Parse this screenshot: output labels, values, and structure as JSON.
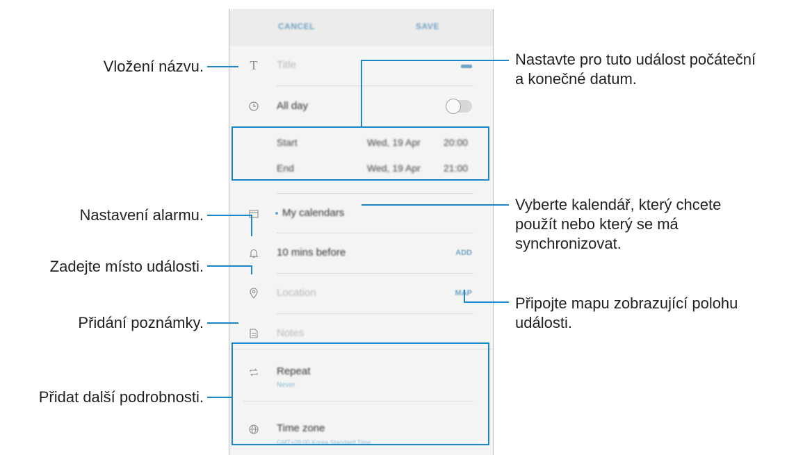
{
  "appbar": {
    "cancel_label": "CANCEL",
    "save_label": "SAVE"
  },
  "form": {
    "title_placeholder": "Title",
    "allday_label": "All day",
    "start_label": "Start",
    "start_date": "Wed, 19 Apr",
    "start_time": "20:00",
    "end_label": "End",
    "end_date": "Wed, 19 Apr",
    "end_time": "21:00",
    "calendar_label": "My calendars",
    "alarm_label": "10 mins before",
    "alarm_action": "ADD",
    "location_placeholder": "Location",
    "location_action": "MAP",
    "notes_placeholder": "Notes",
    "repeat_label": "Repeat",
    "repeat_value": "Never",
    "timezone_label": "Time zone",
    "timezone_value": "GMT+09:00 Korea Standard Time"
  },
  "callouts": {
    "title": "Vložení názvu.",
    "dates_line1": "Nastavte pro tuto událost počáteční",
    "dates_line2": "a konečné datum.",
    "alarm": "Nastavení alarmu.",
    "calendar_line1": "Vyberte kalendář, který chcete",
    "calendar_line2": "použít nebo který se má",
    "calendar_line3": "synchronizovat.",
    "location": "Zadejte místo události.",
    "map_line1": "Připojte mapu zobrazující polohu",
    "map_line2": "události.",
    "notes": "Přidání poznámky.",
    "details": "Přidat další podrobnosti."
  },
  "colors": {
    "accent": "#1a86c6",
    "appbar_bg": "#ececec",
    "form_bg": "#f4f4f4"
  }
}
